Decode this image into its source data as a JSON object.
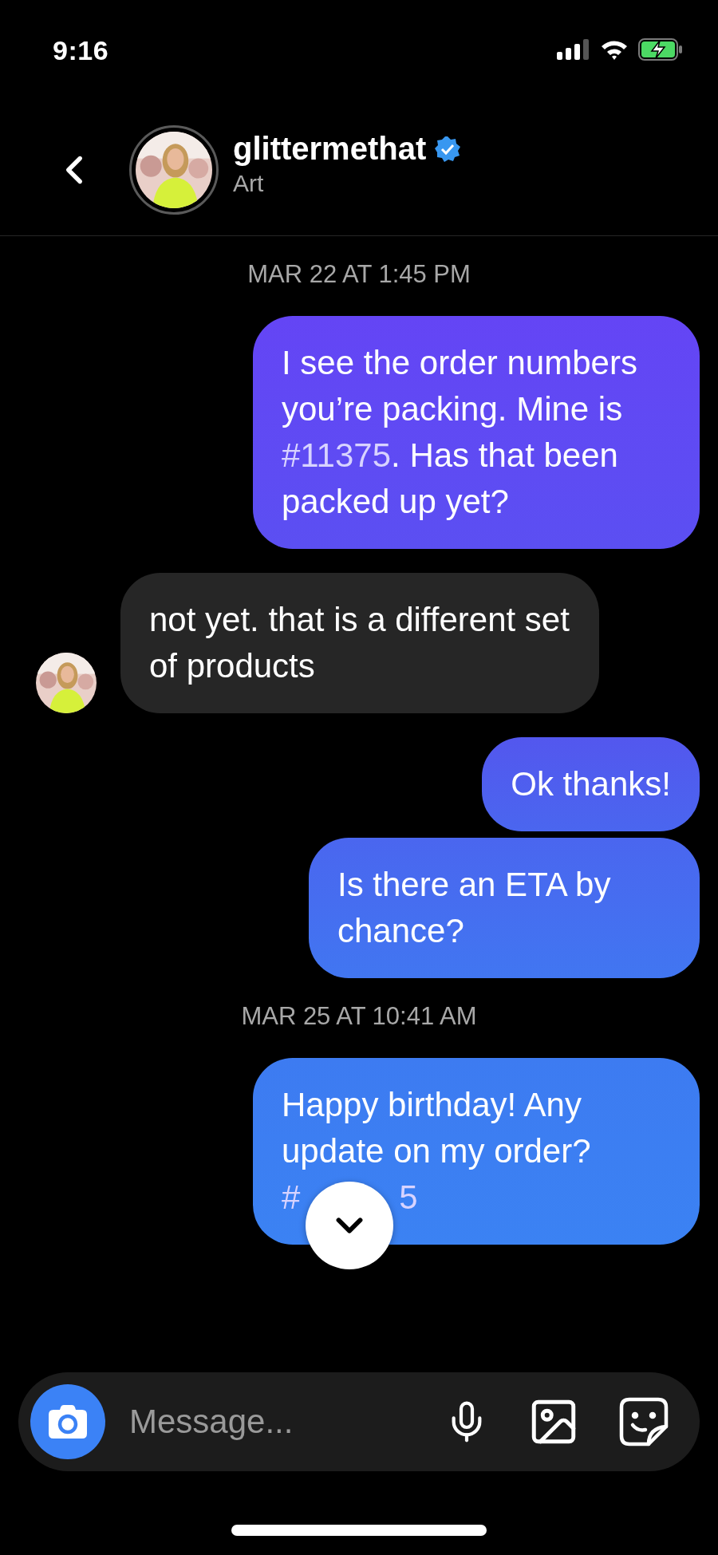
{
  "status_bar": {
    "time": "9:16"
  },
  "header": {
    "name": "glittermethat",
    "verified": true,
    "subtitle": "Art"
  },
  "messages": [
    {
      "kind": "timestamp",
      "text": "MAR 22 AT 1:45 PM"
    },
    {
      "kind": "sent",
      "parts": [
        {
          "kind": "text",
          "text": "I see the order numbers you’re packing. Mine is "
        },
        {
          "kind": "link",
          "text": "#11375"
        },
        {
          "kind": "text",
          "text": ". Has that been packed up yet?"
        }
      ]
    },
    {
      "kind": "received",
      "parts": [
        {
          "kind": "text",
          "text": "not yet. that is a different set of products"
        }
      ]
    },
    {
      "kind": "sent",
      "parts": [
        {
          "kind": "text",
          "text": "Ok thanks!"
        }
      ]
    },
    {
      "kind": "sent",
      "parts": [
        {
          "kind": "text",
          "text": "Is there an ETA by chance?"
        }
      ]
    },
    {
      "kind": "timestamp",
      "text": "MAR 25 AT 10:41 AM"
    },
    {
      "kind": "sent",
      "covered": true,
      "parts": [
        {
          "kind": "text",
          "text": "Happy birthday! Any update on my order?"
        },
        {
          "kind": "link",
          "text": "#"
        },
        {
          "kind": "gap"
        },
        {
          "kind": "link",
          "text": "5"
        }
      ]
    }
  ],
  "composer": {
    "placeholder": "Message..."
  }
}
